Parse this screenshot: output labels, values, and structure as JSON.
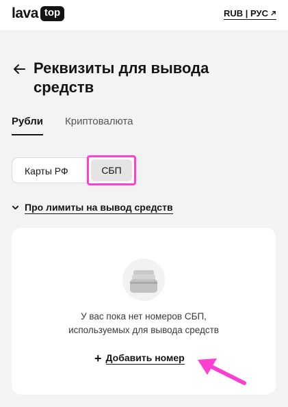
{
  "header": {
    "logo_text": "lava",
    "logo_badge": "top",
    "locale_label": "RUB | РУС"
  },
  "page": {
    "title_line1": "Реквизиты для вывода",
    "title_line2": "средств"
  },
  "tabs": [
    {
      "label": "Рубли",
      "active": true
    },
    {
      "label": "Криптовалюта",
      "active": false
    }
  ],
  "payout_method": {
    "options": [
      "Карты РФ",
      "СБП"
    ],
    "selected": "СБП"
  },
  "limits_link": "Про лимиты на вывод средств",
  "empty_state": {
    "text_line1": "У вас пока нет номеров СБП,",
    "text_line2": "используемых для вывода средств",
    "add_button_label": "Добавить номер"
  },
  "colors": {
    "annotation_pink": "#ff3fcf",
    "text": "#141414",
    "background": "#f3f3f3"
  },
  "icons": {
    "back": "arrow-left-icon",
    "locale": "external-arrow-icon",
    "limits": "chevron-down-icon",
    "empty": "card-stack-icon",
    "add": "plus-icon",
    "annotation": "pink-arrow-annotation"
  }
}
